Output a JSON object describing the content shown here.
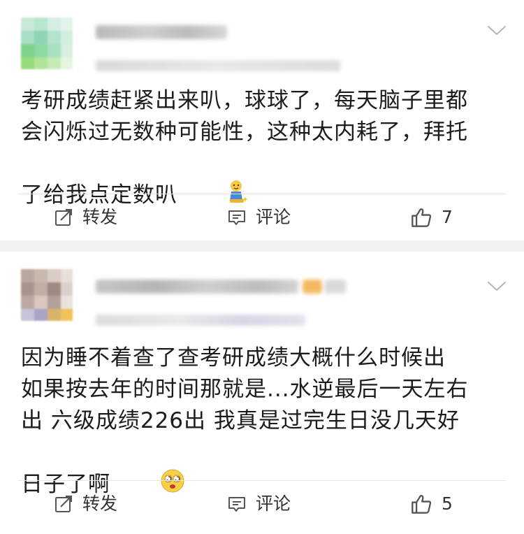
{
  "posts": [
    {
      "content": "考研成绩赶紧出来叭，球球了，每天脑子里都\n会闪烁过无数种可能性，这种太内耗了，拜托\n了给我点定数叭",
      "emoji": "kneeling-pray-emoji",
      "actions": {
        "repost": "转发",
        "comment": "评论",
        "like_count": "7"
      }
    },
    {
      "content": "因为睡不着查了查考研成绩大概什么时候出\n如果按去年的时间那就是...水逆最后一天左右\n出 六级成绩226出 我真是过完生日没几天好\n日子了啊",
      "emoji": "fainting-face-emoji",
      "actions": {
        "repost": "转发",
        "comment": "评论",
        "like_count": "5"
      }
    }
  ],
  "colors": {
    "accent_like": "#333333",
    "separator": "#f2f2f2",
    "text": "#1c1c1c"
  }
}
